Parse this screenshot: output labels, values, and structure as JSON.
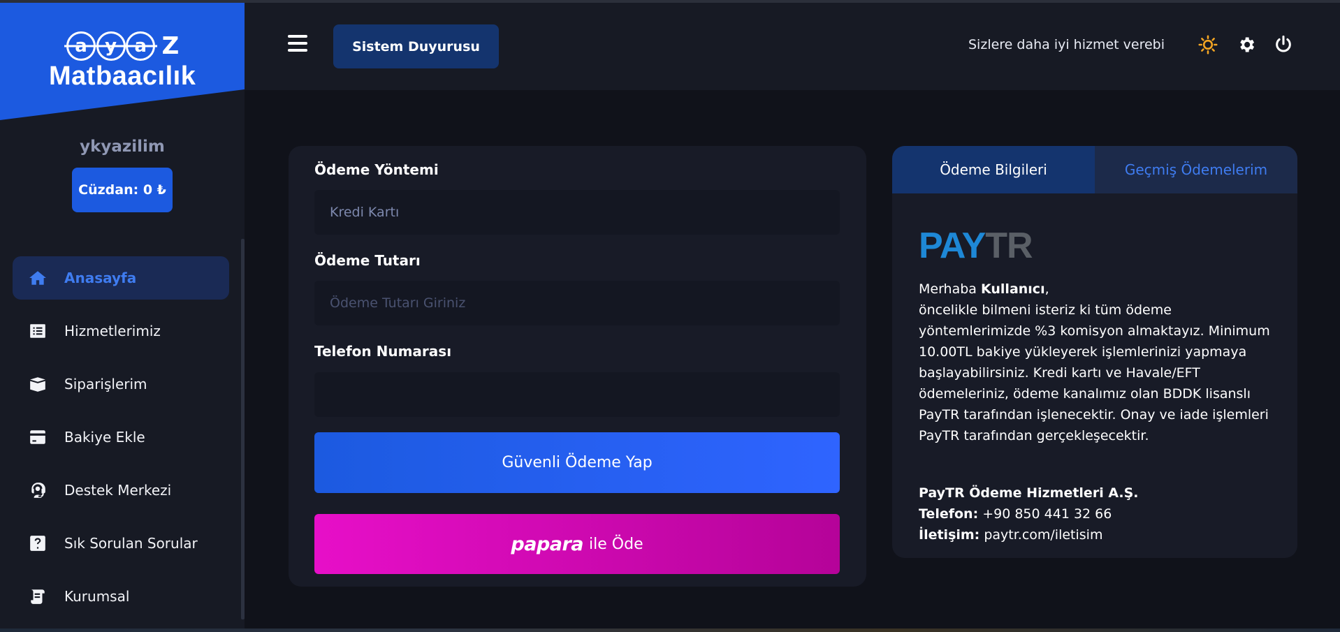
{
  "logo": {
    "line1": [
      "a",
      "y",
      "a",
      "Z"
    ],
    "line2": "Matbaacılık"
  },
  "user": {
    "name": "ykyazilim",
    "wallet": "Cüzdan: 0 ₺"
  },
  "sidebar": {
    "items": [
      {
        "label": "Anasayfa",
        "icon": "home-icon",
        "active": true
      },
      {
        "label": "Hizmetlerimiz",
        "icon": "list-icon"
      },
      {
        "label": "Siparişlerim",
        "icon": "box-icon"
      },
      {
        "label": "Bakiye Ekle",
        "icon": "credit-card-icon"
      },
      {
        "label": "Destek Merkezi",
        "icon": "headset-icon"
      },
      {
        "label": "Sık Sorulan Sorular",
        "icon": "question-icon"
      },
      {
        "label": "Kurumsal",
        "icon": "scroll-icon"
      }
    ]
  },
  "header": {
    "announcement_button": "Sistem Duyurusu",
    "marquee": "Sizlere daha iyi hizmet verebi",
    "icons": [
      "sun-icon",
      "gear-icon",
      "power-icon"
    ],
    "accent": "#f5a623"
  },
  "payment_form": {
    "method_label": "Ödeme Yöntemi",
    "method_value": "Kredi Kartı",
    "amount_label": "Ödeme Tutarı",
    "amount_placeholder": "Ödeme Tutarı Giriniz",
    "phone_label": "Telefon Numarası",
    "phone_value": "",
    "secure_button": "Güvenli Ödeme Yap",
    "papara_logo": "papara",
    "papara_suffix": "ile Öde"
  },
  "info_panel": {
    "tabs": [
      "Ödeme Bilgileri",
      "Geçmiş Ödemelerim"
    ],
    "logo": {
      "pay": "PAY",
      "tr": "TR"
    },
    "greeting_prefix": "Merhaba ",
    "greeting_name": "Kullanıcı",
    "greeting_suffix": ",",
    "body": "öncelikle bilmeni isteriz ki tüm ödeme yöntemlerimizde %3 komisyon almaktayız. Minimum 10.00TL bakiye yükleyerek işlemlerinizi yapmaya başlayabilirsiniz. Kredi kartı ve Havale/EFT ödemeleriniz, ödeme kanalımız olan BDDK lisanslı PayTR tarafından işlenecektir. Onay ve iade işlemleri PayTR tarafından gerçekleşecektir.",
    "company": "PayTR Ödeme Hizmetleri A.Ş.",
    "phone_label": "Telefon:",
    "phone_value": " +90 850 441 32 66",
    "contact_label": "İletişim:",
    "contact_value": " paytr.com/iletisim"
  },
  "colors": {
    "primary": "#1c5ae0",
    "papara": "#e70fc8",
    "background": "#10121a",
    "card": "#181b27"
  }
}
